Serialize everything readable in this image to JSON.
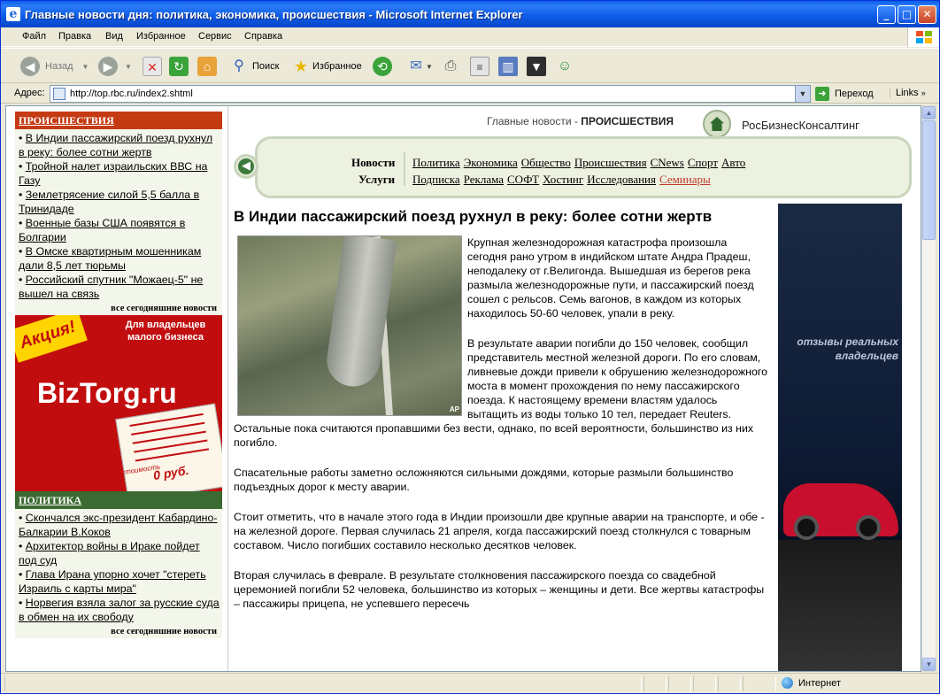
{
  "window": {
    "title": "Главные новости дня: политика, экономика, происшествия - Microsoft Internet Explorer",
    "controls": {
      "minimize": "_",
      "maximize": "□",
      "close": "✕"
    }
  },
  "menu": [
    "Файл",
    "Правка",
    "Вид",
    "Избранное",
    "Сервис",
    "Справка"
  ],
  "toolbar": {
    "back": "Назад",
    "search": "Поиск",
    "favorites": "Избранное"
  },
  "address": {
    "label": "Адрес:",
    "url": "http://top.rbc.ru/index2.shtml",
    "go": "Переход",
    "links": "Links"
  },
  "status": {
    "zone": "Интернет"
  },
  "left": {
    "incidents": {
      "heading": "ПРОИСШЕСТВИЯ",
      "items": [
        "В Индии пассажирский поезд рухнул в реку: более сотни жертв",
        "Тройной налет израильских ВВС на Газу",
        "Землетрясение силой 5,5 балла в Тринидаде",
        "Военные базы США появятся в Болгарии",
        "В Омске квартирным мошенникам дали 8,5 лет тюрьмы",
        "Российский спутник \"Можаец-5\" не вышел на связь"
      ],
      "all_link": "все сегодняшние новости"
    },
    "ad": {
      "badge": "Акция!",
      "tagline": "Для владельцев малого бизнеса",
      "brand": "BizTorg.ru",
      "cost_label": "стоимость",
      "price": "0 руб."
    },
    "politics": {
      "heading": "ПОЛИТИКА",
      "items": [
        "Скончался экс-президент Кабардино-Балкарии В.Коков",
        "Архитектор войны в Ираке пойдет под суд",
        "Глава Ирана упорно хочет \"стереть Израиль с карты мира\"",
        "Норвегия взяла залог за русские суда в обмен на их свободу"
      ],
      "all_link": "все сегодняшние новости"
    }
  },
  "header": {
    "crumb_prefix": "Главные новости - ",
    "crumb_section": "ПРОИСШЕСТВИЯ",
    "brand": "РосБизнесКонсалтинг"
  },
  "nav": {
    "news_label": "Новости",
    "services_label": "Услуги",
    "news_links": [
      "Политика",
      "Экономика",
      "Общество",
      "Происшествия",
      "CNews",
      "Спорт",
      "Авто"
    ],
    "service_links": [
      "Подписка",
      "Реклама",
      "СОФТ",
      "Хостинг",
      "Исследования"
    ],
    "service_link_red": "Семинары"
  },
  "article": {
    "title": "В Индии пассажирский поезд рухнул в реку: более сотни жертв",
    "photo_credit": "AP",
    "paragraphs": [
      "Крупная железнодорожная катастрофа произошла сегодня рано утром в индийском штате Андра Прадеш, неподалеку от г.Велигонда. Вышедшая из берегов река размыла железнодорожные пути, и пассажирский поезд сошел с рельсов. Семь вагонов, в каждом из которых находилось 50-60 человек, упали в реку.",
      "В результате аварии погибли до 150 человек, сообщил представитель местной железной дороги. По его словам, ливневые дожди привели к обрушению железнодорожного моста в момент прохождения по нему пассажирского поезда. К настоящему времени властям удалось вытащить из воды только 10 тел, передает Reuters. Остальные пока считаются пропавшими без вести, однако, по всей вероятности, большинство из них погибло.",
      "Спасательные работы заметно осложняются сильными дождями, которые размыли большинство подъездных дорог к месту аварии.",
      "Стоит отметить, что в начале этого года в Индии произошли две крупные аварии на транспорте, и обе - на железной дороге. Первая случилась 21 апреля, когда пассажирский поезд столкнулся с товарным составом. Число погибших составило несколько десятков человек.",
      "Вторая случилась в феврале. В результате столкновения пассажирского поезда со свадебной церемонией погибли 52 человека, большинство из которых – женщины и дети. Все жертвы катастрофы – пассажиры прицепа, не успевшего пересечь"
    ]
  },
  "right_ad": {
    "text": "отзывы реальных владельцев"
  }
}
